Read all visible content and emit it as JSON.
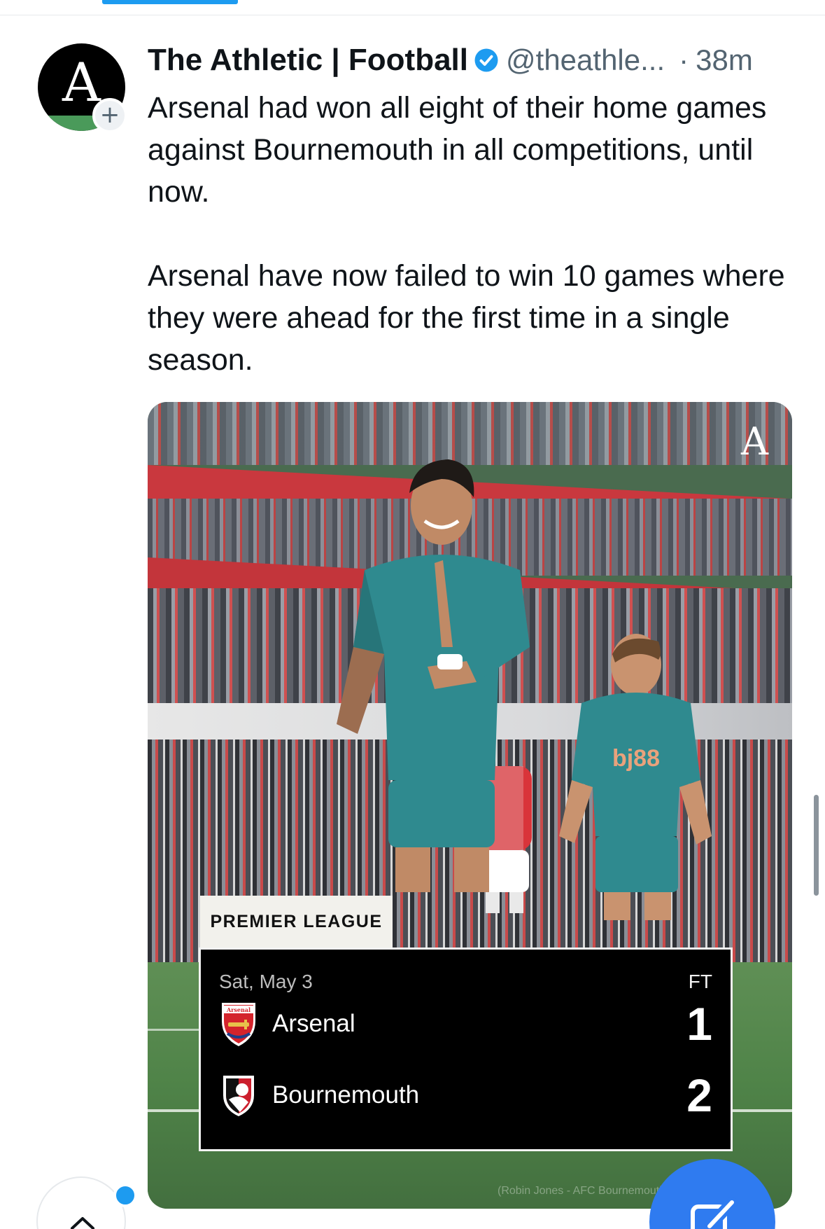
{
  "tweet": {
    "account_name": "The Athletic | Football",
    "handle": "@theathle...",
    "separator": "·",
    "time_ago": "38m",
    "avatar_letter": "A",
    "follow_symbol": "+",
    "paragraphs": [
      "Arsenal had won all eight of their home games against Bournemouth in all competitions, until now.",
      "Arsenal have now failed to win 10 games where they were ahead for the first time in a single season."
    ]
  },
  "media": {
    "brand_mark": "A",
    "league": "PREMIER LEAGUE",
    "date": "Sat, May 3",
    "status": "FT",
    "home_team": {
      "name": "Arsenal",
      "score": "1",
      "crest_icon": "arsenal-crest-icon",
      "crest_text": "Arsenal"
    },
    "away_team": {
      "name": "Bournemouth",
      "score": "2",
      "crest_icon": "bournemouth-crest-icon"
    },
    "credit": "(Robin Jones - AFC Bournemouth via Getty Images)"
  },
  "colors": {
    "accent": "#1d9bf0",
    "fab": "#2f7bf0",
    "text_primary": "#0f1419",
    "text_secondary": "#536471",
    "kit_teal": "#2f8a8f"
  },
  "icons": [
    "verified-badge-icon",
    "compose-icon",
    "chevron-up-icon",
    "plus-icon"
  ]
}
